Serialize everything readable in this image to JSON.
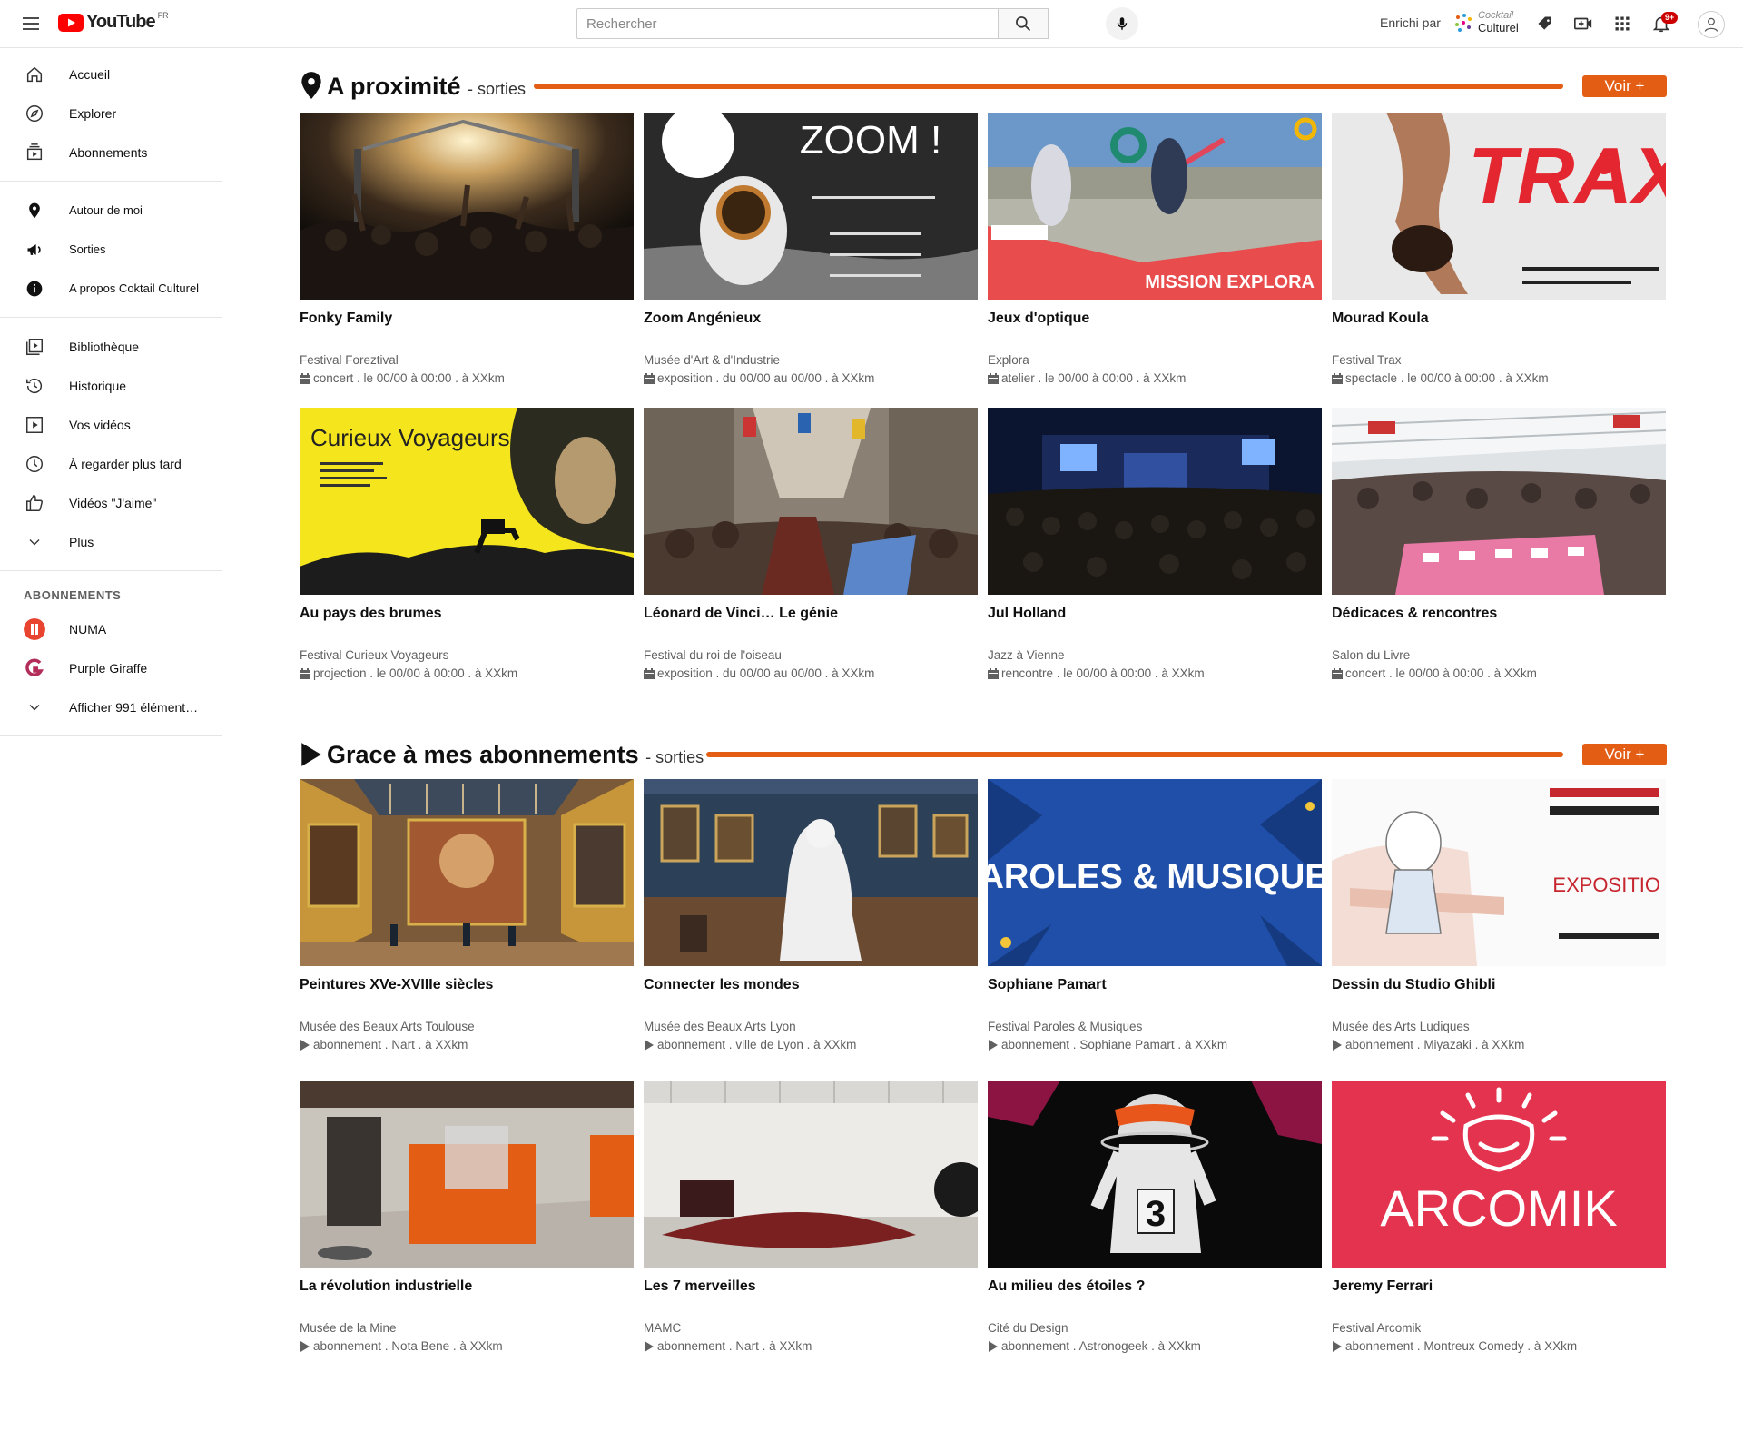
{
  "header": {
    "brand": "YouTube",
    "region": "FR",
    "search_placeholder": "Rechercher",
    "enrichi_label": "Enrichi par",
    "partner_line1": "Cocktail",
    "partner_line2": "Culturel",
    "notification_badge": "9+"
  },
  "sidebar": {
    "main": [
      {
        "label": "Accueil",
        "icon": "home-icon"
      },
      {
        "label": "Explorer",
        "icon": "compass-icon"
      },
      {
        "label": "Abonnements",
        "icon": "subscriptions-icon"
      }
    ],
    "coktail": [
      {
        "label": "Autour de moi",
        "icon": "location-pin-icon"
      },
      {
        "label": "Sorties",
        "icon": "megaphone-icon"
      },
      {
        "label": "A propos Coktail Culturel",
        "icon": "info-icon"
      }
    ],
    "library": [
      {
        "label": "Bibliothèque",
        "icon": "library-icon"
      },
      {
        "label": "Historique",
        "icon": "history-icon"
      },
      {
        "label": "Vos vidéos",
        "icon": "play-square-icon"
      },
      {
        "label": "À regarder plus tard",
        "icon": "clock-icon"
      },
      {
        "label": "Vidéos \"J'aime\"",
        "icon": "thumbs-up-icon"
      },
      {
        "label": "Plus",
        "icon": "chevron-down-icon"
      }
    ],
    "subscriptions_header": "ABONNEMENTS",
    "channels": [
      {
        "label": "NUMA",
        "color": "#e8442f"
      },
      {
        "label": "Purple Giraffe",
        "color": "#b32d5a"
      }
    ],
    "show_more": "Afficher 991 élément…"
  },
  "sections": [
    {
      "title": "A proximité",
      "subtitle": "- sorties",
      "button": "Voir +",
      "items": [
        {
          "title": "Fonky Family",
          "venue": "Festival Foreztival",
          "meta": "concert . le 00/00 à 00:00 . à XXkm",
          "thumb_text": ""
        },
        {
          "title": "Zoom Angénieux",
          "venue": "Musée d'Art & d'Industrie",
          "meta": "exposition . du 00/00 au 00/00 . à XXkm",
          "thumb_text": "ZOOM !"
        },
        {
          "title": "Jeux d'optique",
          "venue": "Explora",
          "meta": "atelier . le 00/00 à 00:00 . à XXkm",
          "thumb_text": "MISSION EXPLORA"
        },
        {
          "title": "Mourad Koula",
          "venue": "Festival Trax",
          "meta": "spectacle . le 00/00 à 00:00 . à XXkm",
          "thumb_text": "TRAX"
        },
        {
          "title": "Au pays des brumes",
          "venue": "Festival Curieux Voyageurs",
          "meta": "projection . le 00/00 à 00:00 . à XXkm",
          "thumb_text": "Curieux Voyageurs"
        },
        {
          "title": "Léonard de Vinci… Le génie",
          "venue": "Festival du roi de l'oiseau",
          "meta": "exposition . du 00/00 au 00/00 . à XXkm",
          "thumb_text": ""
        },
        {
          "title": "Jul Holland",
          "venue": "Jazz à Vienne",
          "meta": "rencontre . le 00/00 à 00:00 . à XXkm",
          "thumb_text": ""
        },
        {
          "title": "Dédicaces & rencontres",
          "venue": "Salon du Livre",
          "meta": "concert . le 00/00 à 00:00 . à XXkm",
          "thumb_text": ""
        }
      ]
    },
    {
      "title": "Grace à mes abonnements",
      "subtitle": "- sorties",
      "button": "Voir +",
      "items": [
        {
          "title": "Peintures XVe-XVIIIe siècles",
          "venue": "Musée des Beaux Arts Toulouse",
          "meta": "abonnement . Nart . à XXkm",
          "thumb_text": ""
        },
        {
          "title": "Connecter les mondes",
          "venue": "Musée des Beaux Arts Lyon",
          "meta": "abonnement . ville de Lyon . à XXkm",
          "thumb_text": ""
        },
        {
          "title": "Sophiane Pamart",
          "venue": "Festival Paroles & Musiques",
          "meta": "abonnement . Sophiane Pamart . à XXkm",
          "thumb_text": "PAROLES & MUSIQUES"
        },
        {
          "title": "Dessin du Studio Ghibli",
          "venue": "Musée des Arts Ludiques",
          "meta": "abonnement . Miyazaki . à XXkm",
          "thumb_text": "EXPOSITIO"
        },
        {
          "title": "La révolution industrielle",
          "venue": "Musée de la Mine",
          "meta": "abonnement . Nota Bene . à XXkm",
          "thumb_text": ""
        },
        {
          "title": "Les 7 merveilles",
          "venue": "MAMC",
          "meta": "abonnement . Nart . à XXkm",
          "thumb_text": ""
        },
        {
          "title": "Au milieu des étoiles ?",
          "venue": "Cité du Design",
          "meta": "abonnement . Astronogeek . à XXkm",
          "thumb_text": "3"
        },
        {
          "title": "Jeremy Ferrari",
          "venue": "Festival Arcomik",
          "meta": "abonnement . Montreux Comedy . à XXkm",
          "thumb_text": "ARCOMIK"
        }
      ]
    }
  ],
  "colors": {
    "accent": "#e35d14",
    "youtube_red": "#ff0000"
  }
}
